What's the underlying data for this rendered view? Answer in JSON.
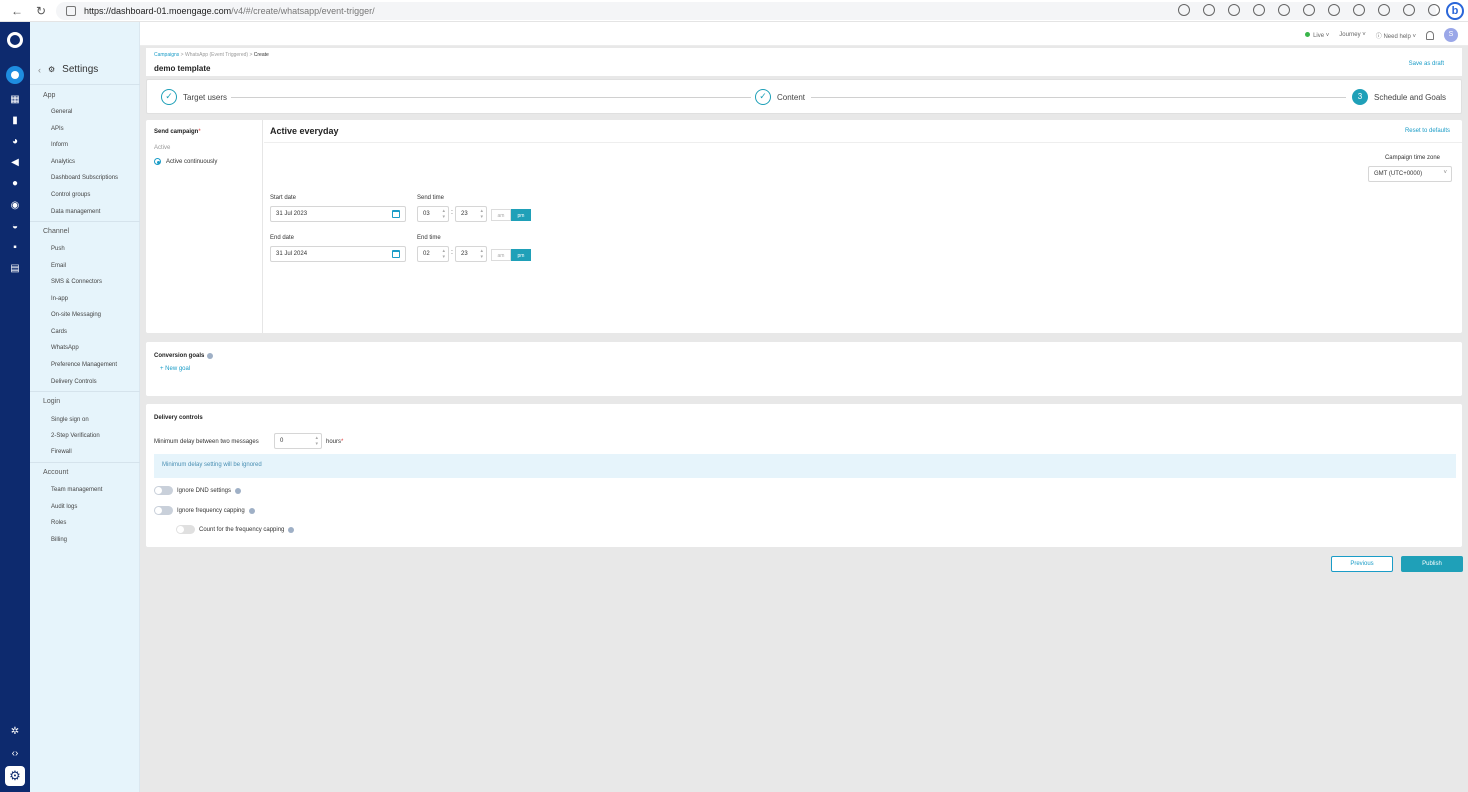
{
  "browser": {
    "url_host": "https://dashboard-01.moengage.com",
    "url_path": "/v4/#/create/whatsapp/event-trigger/",
    "profile_letter": "b"
  },
  "sidebar": {
    "title": "Settings",
    "sections": [
      {
        "label": "App",
        "items": [
          "General",
          "APIs",
          "Inform",
          "Analytics",
          "Dashboard Subscriptions",
          "Control groups",
          "Data management"
        ]
      },
      {
        "label": "Channel",
        "items": [
          "Push",
          "Email",
          "SMS & Connectors",
          "In-app",
          "On-site Messaging",
          "Cards",
          "WhatsApp",
          "Preference Management",
          "Delivery Controls"
        ]
      },
      {
        "label": "Login",
        "items": [
          "Single sign on",
          "2-Step Verification",
          "Firewall"
        ]
      },
      {
        "label": "Account",
        "items": [
          "Team management",
          "Audit logs",
          "Roles",
          "Billing"
        ]
      }
    ]
  },
  "topbar": {
    "live": "Live",
    "journey": "Journey",
    "need_help": "Need help",
    "avatar": "S"
  },
  "header": {
    "breadcrumb_link": "Campaigns",
    "breadcrumb_mid": " > WhatsApp (Event Triggered) > ",
    "breadcrumb_current": "Create",
    "title": "demo template",
    "save_draft": "Save as draft"
  },
  "steps": [
    {
      "label": "Target users",
      "state": "done"
    },
    {
      "label": "Content",
      "state": "done"
    },
    {
      "label": "Schedule and Goals",
      "state": "current",
      "number": "3"
    }
  ],
  "schedule": {
    "send_campaign": "Send campaign",
    "active_label": "Active",
    "option": "Active continuously",
    "section_title": "Active everyday",
    "reset": "Reset to defaults",
    "tz_label": "Campaign time zone",
    "tz_value": "GMT (UTC+0000)",
    "start_date_label": "Start date",
    "start_date": "31 Jul 2023",
    "send_time_label": "Send time",
    "send_hour": "03",
    "send_min": "23",
    "end_date_label": "End date",
    "end_date": "31 Jul 2024",
    "end_time_label": "End time",
    "end_hour": "02",
    "end_min": "23",
    "am": "am",
    "pm": "pm"
  },
  "goals": {
    "title": "Conversion goals",
    "new_goal": "+ New goal"
  },
  "delivery": {
    "title": "Delivery controls",
    "min_delay_label": "Minimum delay between two messages",
    "min_delay_value": "0",
    "hours": "hours",
    "banner": "Minimum delay setting will be ignored",
    "ignore_dnd": "Ignore DND settings",
    "ignore_freq": "Ignore frequency capping",
    "count_freq": "Count for the frequency capping"
  },
  "actions": {
    "previous": "Previous",
    "publish": "Publish"
  },
  "colors": {
    "accent": "#1fa0b8",
    "rail": "#0d2a6e",
    "sidebar_bg": "#e6f4fb"
  }
}
